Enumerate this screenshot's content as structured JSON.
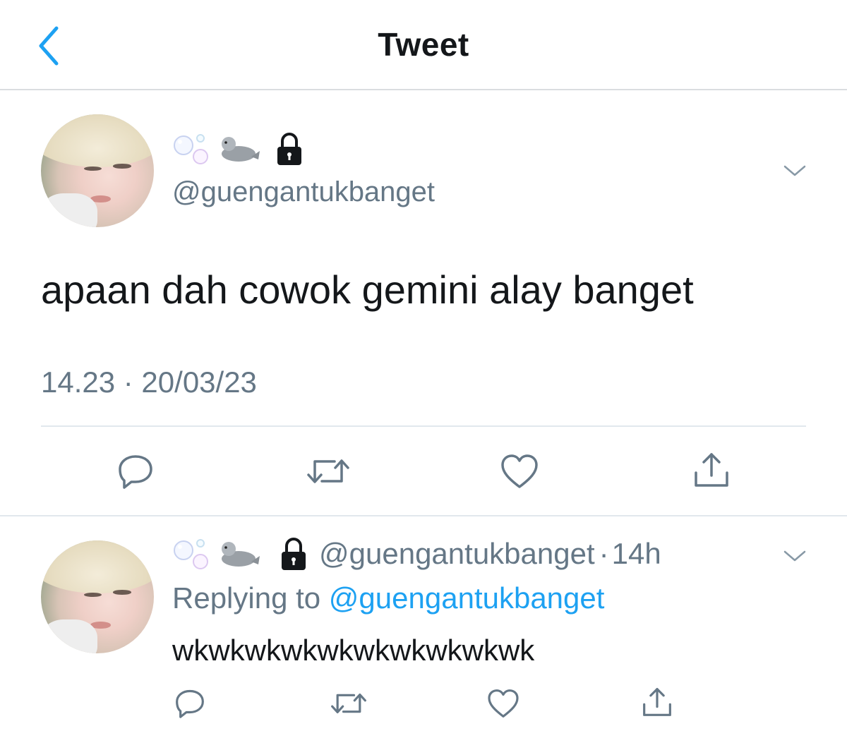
{
  "header": {
    "title": "Tweet",
    "back_icon": "chevron-left-icon",
    "accent_color": "#1da1f2"
  },
  "main_tweet": {
    "display_name_icons": [
      "bubbles-icon",
      "seal-icon",
      "lock-icon"
    ],
    "handle": "@guengantukbanget",
    "text": "apaan dah cowok gemini alay banget",
    "timestamp": "14.23 · 20/03/23",
    "menu_icon": "chevron-down-icon",
    "actions": [
      "reply-icon",
      "retweet-icon",
      "like-icon",
      "share-icon"
    ]
  },
  "reply_tweet": {
    "display_name_icons": [
      "bubbles-icon",
      "seal-icon",
      "lock-icon"
    ],
    "handle": "@guengantukbanget",
    "separator": "·",
    "time_ago": "14h",
    "replying_prefix": "Replying to",
    "replying_to": "@guengantukbanget",
    "text": "wkwkwkwkwkwkwkwkwkwk",
    "menu_icon": "chevron-down-icon",
    "actions": [
      "reply-icon",
      "retweet-icon",
      "like-icon",
      "share-icon"
    ]
  }
}
